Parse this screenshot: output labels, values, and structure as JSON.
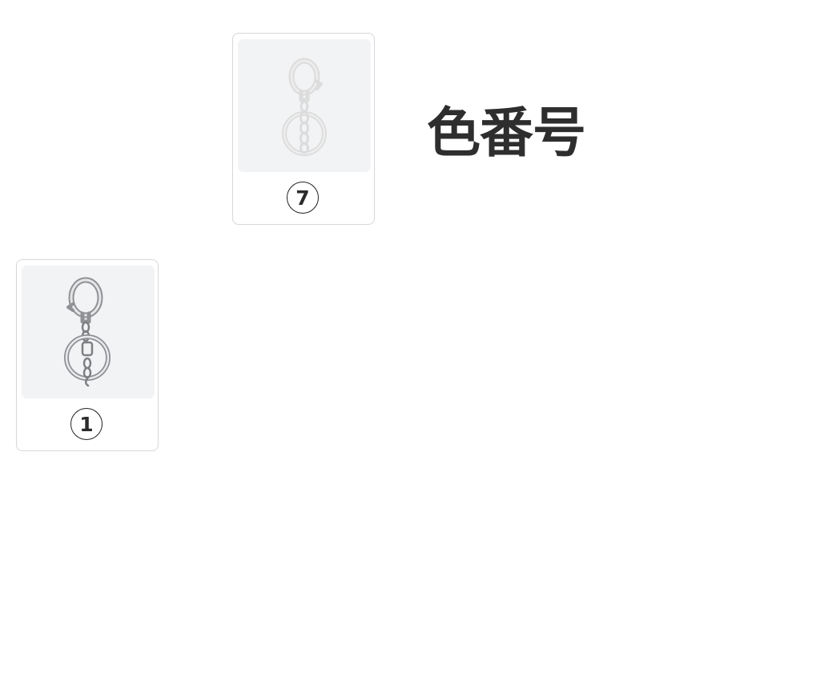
{
  "heading": "色番号",
  "swatches": [
    {
      "number": "7",
      "image": "keyring-clasp-clear-icon",
      "selected": false
    },
    {
      "number": "1",
      "image": "keyring-clasp-silver-icon",
      "selected": false
    }
  ],
  "colors": {
    "card_border": "#d7d7d9",
    "thumb_background": "#f2f3f5",
    "heading_text": "#2e2e2e",
    "badge_border": "#222222"
  }
}
